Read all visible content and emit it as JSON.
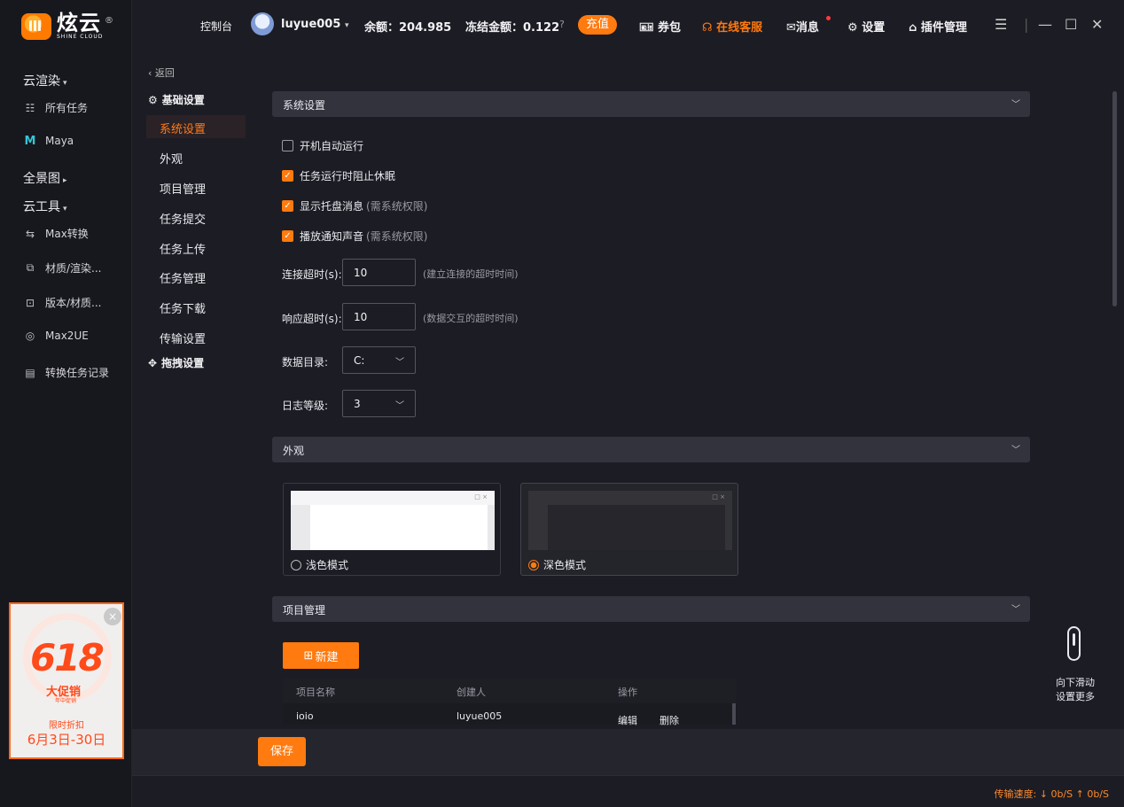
{
  "brand": {
    "name_cn": "炫云",
    "name_en": "SHINE CLOUD",
    "reg": "®"
  },
  "rail": {
    "groups": [
      {
        "label": "云渲染",
        "caret": "▾"
      },
      {
        "label": "全景图",
        "caret": "▸"
      },
      {
        "label": "云工具",
        "caret": "▾"
      }
    ],
    "items": [
      {
        "label": "所有任务",
        "icon": "list-icon"
      },
      {
        "label": "Maya",
        "icon": "maya-icon"
      },
      {
        "label": "Max转换",
        "icon": "convert-icon"
      },
      {
        "label": "材质/渲染...",
        "icon": "material-icon"
      },
      {
        "label": "版本/材质...",
        "icon": "version-icon"
      },
      {
        "label": "Max2UE",
        "icon": "max2ue-icon"
      },
      {
        "label": "转换任务记录",
        "icon": "record-icon"
      }
    ]
  },
  "ad": {
    "number": "618",
    "promo": "大促销",
    "sub1": "年中促销",
    "sub2": "限时折扣",
    "date": "6月3日-30日",
    "close": "×"
  },
  "topbar": {
    "console": "控制台",
    "username": "luyue005",
    "user_caret": "▾",
    "balance": "余额：204.985",
    "frozen": "冻结金额：0.122",
    "help": "?",
    "recharge": "充值",
    "coupon": "券包",
    "support": "在线客服",
    "message": "消息",
    "settings": "设置",
    "plugins": "插件管理",
    "menu": "☰",
    "minimize": "—",
    "maximize": "☐",
    "close": "✕"
  },
  "subnav": {
    "back": "‹ 返回",
    "basic": "基础设置",
    "items": [
      "系统设置",
      "外观",
      "项目管理",
      "任务提交",
      "任务上传",
      "任务管理",
      "任务下载",
      "传输设置"
    ],
    "drag": "拖拽设置"
  },
  "system": {
    "title": "系统设置",
    "checks": [
      {
        "label": "开机自动运行",
        "hint": "",
        "checked": false
      },
      {
        "label": "任务运行时阻止休眠",
        "hint": "",
        "checked": true
      },
      {
        "label": "显示托盘消息",
        "hint": "(需系统权限)",
        "checked": true
      },
      {
        "label": "播放通知声音",
        "hint": "(需系统权限)",
        "checked": true
      }
    ],
    "connect_label": "连接超时(s):",
    "connect_value": "10",
    "connect_hint": "(建立连接的超时时间)",
    "response_label": "响应超时(s):",
    "response_value": "10",
    "response_hint": "(数据交互的超时时间)",
    "dir_label": "数据目录:",
    "dir_value": "C:",
    "log_label": "日志等级:",
    "log_value": "3"
  },
  "appearance": {
    "title": "外观",
    "light": "浅色模式",
    "dark": "深色模式",
    "selected": "dark"
  },
  "project": {
    "title": "项目管理",
    "new": "新建",
    "columns": [
      "项目名称",
      "创建人",
      "操作"
    ],
    "rows": [
      {
        "name": "ioio",
        "creator": "luyue005",
        "edit": "编辑",
        "delete": "删除"
      }
    ]
  },
  "save": "保存",
  "scroll_hint": {
    "line1": "向下滑动",
    "line2": "设置更多"
  },
  "status": {
    "speed": "传输速度: ↓ 0b/S ↑ 0b/S"
  },
  "colors": {
    "accent": "#ff7a0f",
    "bg": "#1c1c24",
    "panel": "#33333e"
  }
}
